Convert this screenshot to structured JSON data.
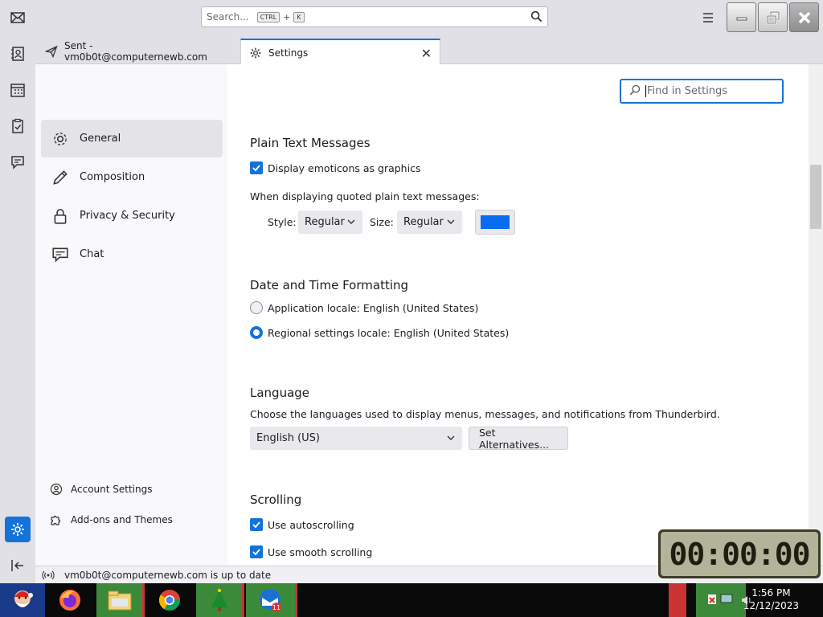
{
  "titlebar": {
    "search_placeholder": "Search...",
    "search_shortcut_ctrl": "CTRL",
    "search_shortcut_plus": "+",
    "search_shortcut_key": "K"
  },
  "tabs": [
    {
      "label": "Sent - vm0b0t@computernewb.com",
      "icon": "paper-plane-icon"
    },
    {
      "label": "Settings",
      "icon": "gear-icon",
      "selected": true
    }
  ],
  "categories": [
    {
      "label": "General",
      "icon": "gear-icon",
      "active": true
    },
    {
      "label": "Composition",
      "icon": "pencil-icon"
    },
    {
      "label": "Privacy & Security",
      "icon": "lock-icon"
    },
    {
      "label": "Chat",
      "icon": "chat-icon"
    }
  ],
  "footer_links": [
    {
      "label": "Account Settings",
      "icon": "account-icon"
    },
    {
      "label": "Add-ons and Themes",
      "icon": "puzzle-icon"
    }
  ],
  "find_placeholder": "Find in Settings",
  "plain_text": {
    "heading": "Plain Text Messages",
    "emoticons_label": "Display emoticons as graphics",
    "emoticons_checked": true,
    "quoted_label": "When displaying quoted plain text messages:",
    "style_label": "Style:",
    "style_value": "Regular",
    "size_label": "Size:",
    "size_value": "Regular",
    "color": "#0a6cf0"
  },
  "date_time": {
    "heading": "Date and Time Formatting",
    "app_locale_label": "Application locale: English (United States)",
    "regional_locale_label": "Regional settings locale: English (United States)",
    "selected": "regional"
  },
  "language": {
    "heading": "Language",
    "description": "Choose the languages used to display menus, messages, and notifications from Thunderbird.",
    "selected": "English (US)",
    "alternatives_button": "Set Alternatives..."
  },
  "scrolling": {
    "heading": "Scrolling",
    "autoscroll_label": "Use autoscrolling",
    "autoscroll_checked": true,
    "smooth_label": "Use smooth scrolling",
    "smooth_checked": true
  },
  "status": {
    "text": "vm0b0t@computernewb.com is up to date"
  },
  "clock_widget": {
    "time": "00:00:00"
  },
  "taskbar": {
    "time": "1:56 PM",
    "date": "12/12/2023",
    "mail_badge": "11"
  },
  "colors": {
    "accent": "#1373d9"
  }
}
